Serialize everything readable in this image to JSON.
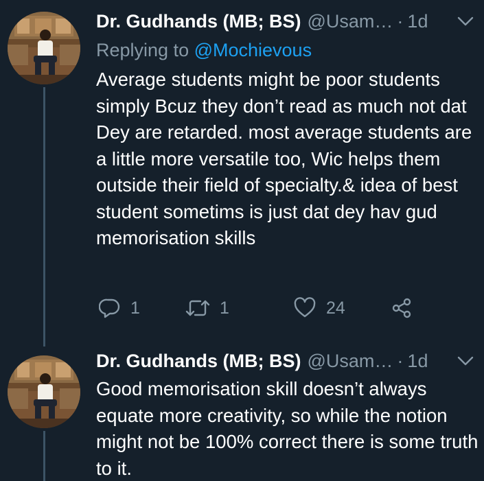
{
  "tweets": [
    {
      "author_name": "Dr. Gudhands (MB; BS)",
      "handle": "@Usam…",
      "separator": "·",
      "time": "1d",
      "reply_prefix": "Replying to ",
      "reply_mention": "@Mochievous",
      "text": "Average students might be poor students simply Bcuz they don’t read as much not dat Dey are retarded. most average students are a little more versatile too, Wic helps them outside their field of specialty.& idea of best student sometims is just dat dey hav gud memorisation skills",
      "stats": {
        "replies": "1",
        "retweets": "1",
        "likes": "24"
      }
    },
    {
      "author_name": "Dr. Gudhands (MB; BS)",
      "handle": "@Usam…",
      "separator": "·",
      "time": "1d",
      "text": "Good memorisation skill doesn’t always equate more creativity, so while the notion might not be 100% correct there is some truth to it."
    }
  ],
  "icons": {
    "chevron": "chevron-down-icon",
    "reply": "reply-icon",
    "retweet": "retweet-icon",
    "like": "heart-icon",
    "share": "share-icon"
  },
  "colors": {
    "background": "#15202b",
    "text_primary": "#ffffff",
    "text_secondary": "#8899a6",
    "link": "#1da1f2",
    "thread_line": "#3d5466"
  }
}
